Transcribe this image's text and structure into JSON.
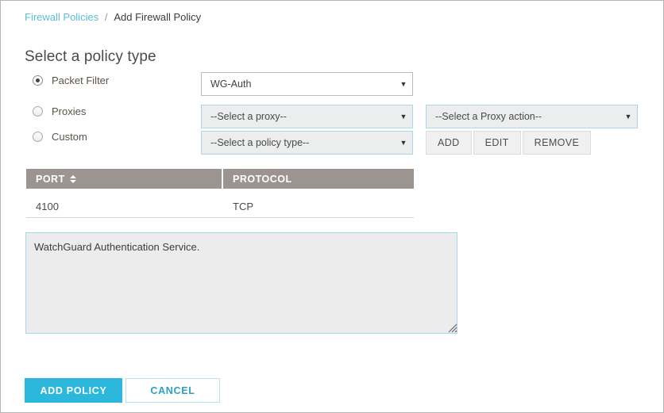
{
  "breadcrumb": {
    "parent": "Firewall Policies",
    "separator": "/",
    "current": "Add Firewall Policy"
  },
  "section": {
    "title": "Select a policy type"
  },
  "policy_type": {
    "options": [
      {
        "label": "Packet Filter",
        "selected": true
      },
      {
        "label": "Proxies",
        "selected": false
      },
      {
        "label": "Custom",
        "selected": false
      }
    ]
  },
  "selects": {
    "packet_filter": {
      "value": "WG-Auth",
      "enabled": true,
      "arrow": "chevron-down-icon"
    },
    "proxy": {
      "value": "--Select a proxy--",
      "enabled": false,
      "arrow": "chevron-down-icon"
    },
    "policy_type": {
      "value": "--Select a policy type--",
      "enabled": false,
      "arrow": "chevron-down-icon"
    },
    "proxy_action": {
      "value": "--Select a Proxy action--",
      "enabled": false,
      "arrow": "chevron-down-icon"
    }
  },
  "proxy_action_buttons": [
    {
      "label": "ADD"
    },
    {
      "label": "EDIT"
    },
    {
      "label": "REMOVE"
    }
  ],
  "ports_table": {
    "columns": [
      {
        "key": "port",
        "label": "PORT",
        "sortable": true,
        "sort_icon": "sort-arrows-icon"
      },
      {
        "key": "protocol",
        "label": "PROTOCOL",
        "sortable": true
      }
    ],
    "rows": [
      {
        "port": "4100",
        "protocol": "TCP"
      }
    ]
  },
  "description": {
    "value": "WatchGuard Authentication Service.",
    "placeholder": "",
    "resize_handle": "resize-grip-icon"
  },
  "footer": {
    "submit_label": "ADD POLICY",
    "cancel_label": "CANCEL"
  },
  "colors": {
    "accent": "#2cb8dc",
    "link": "#5bbcd8",
    "table_header": "#9b9490",
    "disabled_field": "#eceded",
    "field_border_active": "#a3dbe9"
  }
}
